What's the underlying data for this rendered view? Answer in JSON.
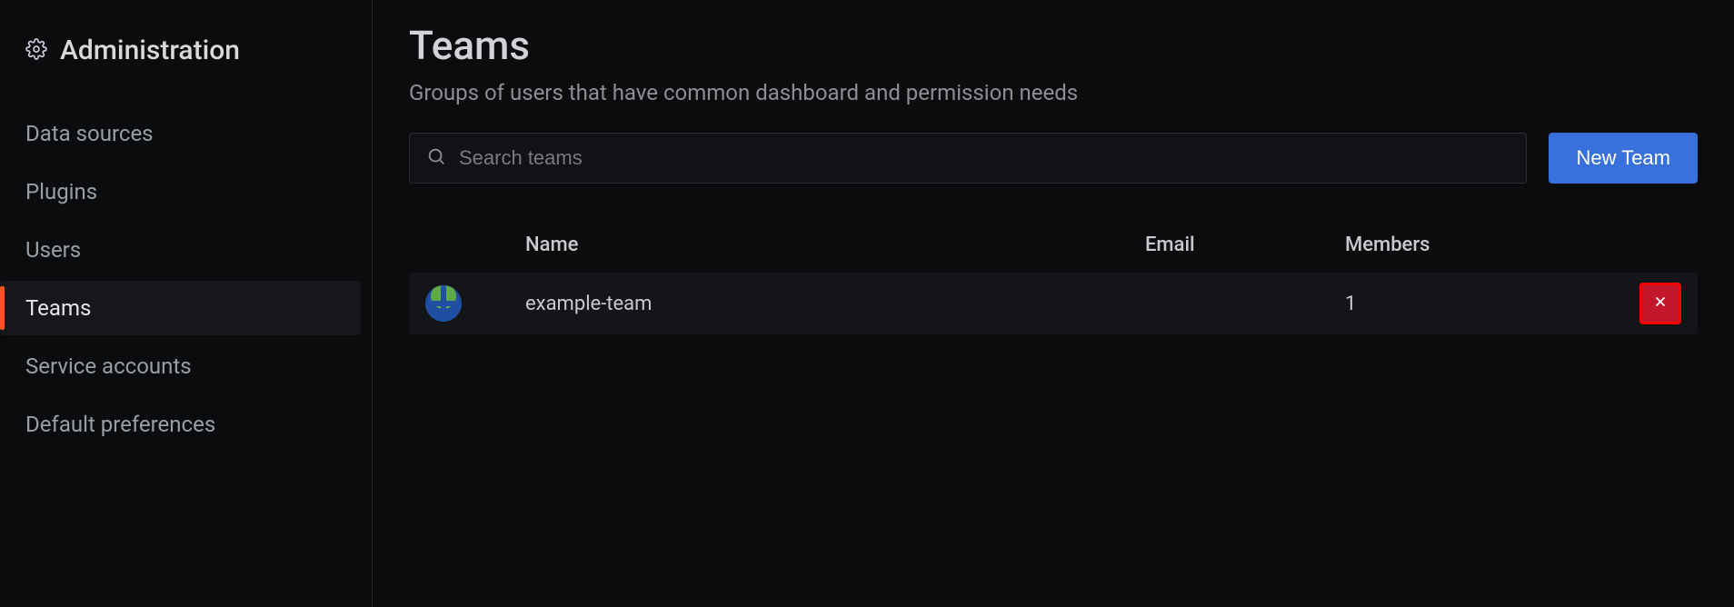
{
  "sidebar": {
    "title": "Administration",
    "items": [
      {
        "label": "Data sources",
        "active": false
      },
      {
        "label": "Plugins",
        "active": false
      },
      {
        "label": "Users",
        "active": false
      },
      {
        "label": "Teams",
        "active": true
      },
      {
        "label": "Service accounts",
        "active": false
      },
      {
        "label": "Default preferences",
        "active": false
      }
    ]
  },
  "page": {
    "title": "Teams",
    "subtitle": "Groups of users that have common dashboard and permission needs"
  },
  "search": {
    "placeholder": "Search teams",
    "value": ""
  },
  "buttons": {
    "new_team": "New Team"
  },
  "table": {
    "headers": {
      "name": "Name",
      "email": "Email",
      "members": "Members"
    },
    "rows": [
      {
        "name": "example-team",
        "email": "",
        "members": "1"
      }
    ]
  }
}
